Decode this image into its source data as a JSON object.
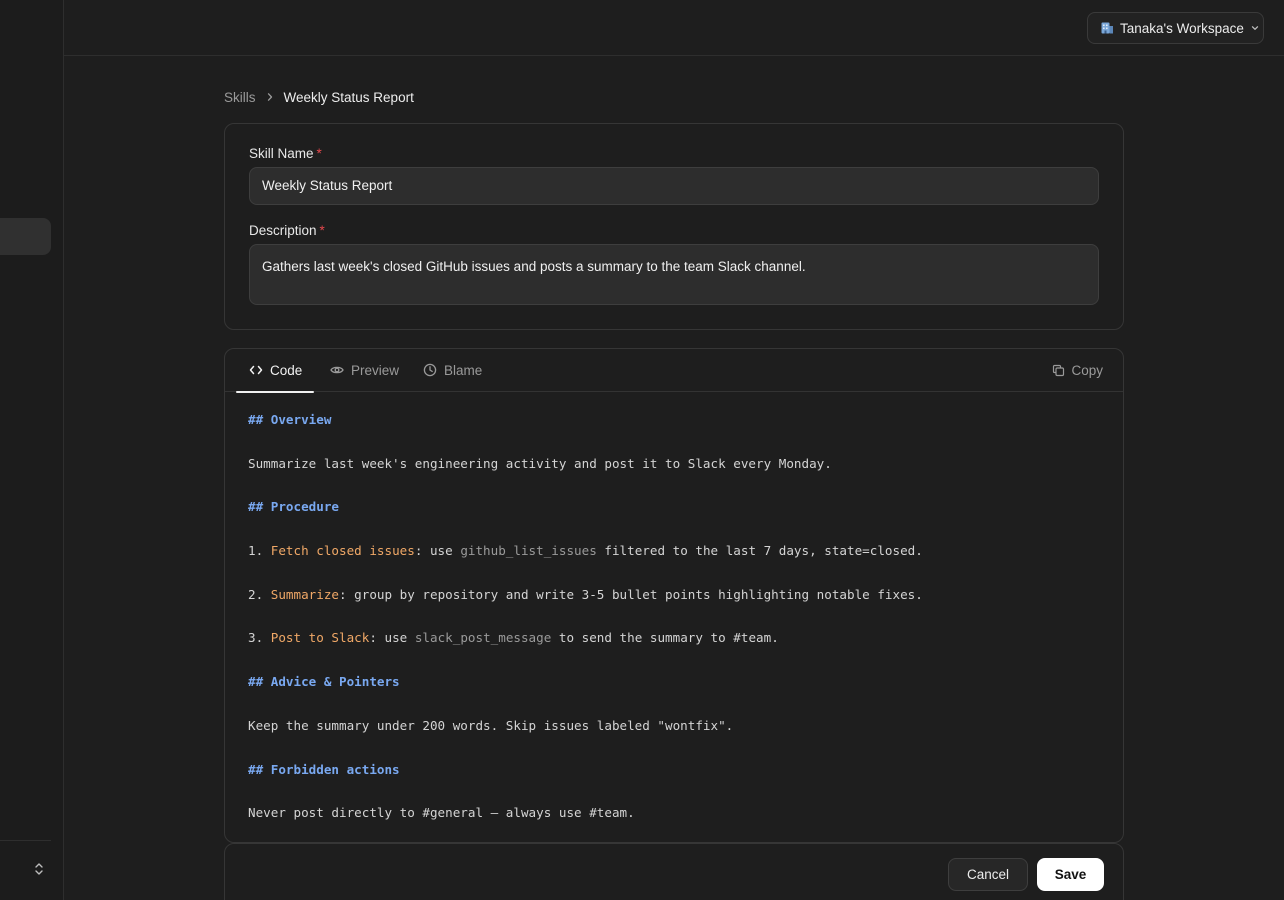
{
  "workspace": {
    "icon": "building-icon",
    "label": "Tanaka's Workspace"
  },
  "breadcrumb": {
    "parent": "Skills",
    "current": "Weekly Status Report"
  },
  "form": {
    "name_label": "Skill Name",
    "name_value": "Weekly Status Report",
    "description_label": "Description",
    "description_value": "Gathers last week's closed GitHub issues and posts a summary to the team Slack channel.",
    "required_marker": "*"
  },
  "editor": {
    "tabs": {
      "code": "Code",
      "preview": "Preview",
      "blame": "Blame"
    },
    "active_tab": "Code",
    "copy_label": "Copy",
    "lines": {
      "h_overview": "## Overview",
      "overview": "Summarize last week's engineering activity and post it to Slack every Monday.",
      "h_procedure": "## Procedure",
      "step1": {
        "num": "1. ",
        "title": "Fetch closed issues",
        "a": ": use ",
        "fn": "github_list_issues",
        "b": " filtered to the last 7 days, state=closed."
      },
      "step2": {
        "num": "2. ",
        "title": "Summarize",
        "a": ": group by repository and write 3-5 bullet points highlighting notable fixes."
      },
      "step3": {
        "num": "3. ",
        "title": "Post to Slack",
        "a": ": use ",
        "fn": "slack_post_message",
        "b": " to send the summary to #team."
      },
      "h_advice": "## Advice & Pointers",
      "advice": "Keep the summary under 200 words. Skip issues labeled \"wontfix\".",
      "h_forbidden": "## Forbidden actions",
      "forbidden": "Never post directly to #general — always use #team."
    }
  },
  "footer": {
    "cancel_label": "Cancel",
    "save_label": "Save"
  },
  "colors": {
    "background": "#1e1e1e",
    "heading": "#79a8f0",
    "step_highlight": "#f0a867",
    "required": "#e5484d",
    "primary_button": "#ffffff"
  }
}
